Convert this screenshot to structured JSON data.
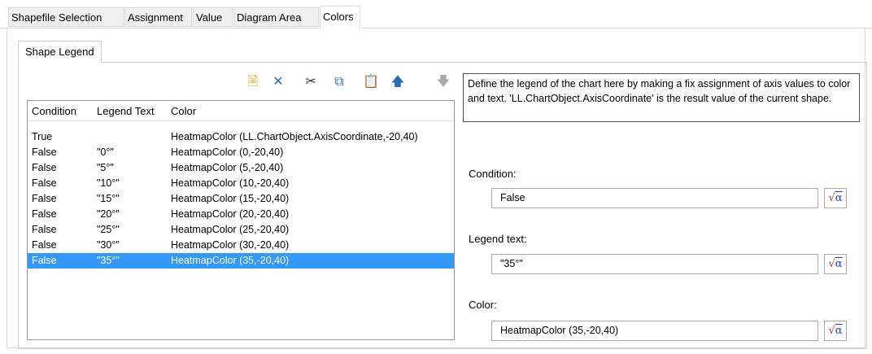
{
  "tabs": [
    "Shapefile Selection",
    "Assignment",
    "Value",
    "Diagram Area",
    "Colors"
  ],
  "active_tab": "Colors",
  "subtab": "Shape Legend",
  "toolbar": {
    "icons": [
      "new-icon",
      "delete-icon",
      "cut-icon",
      "copy-icon",
      "paste-icon",
      "move-up-icon",
      "move-down-icon"
    ],
    "glyphs": [
      "🗎",
      "✕",
      "✂",
      "⧉",
      "📋",
      "🡅",
      "🡇"
    ],
    "colors": [
      "#d4a017",
      "#2b6cb0",
      "#333333",
      "#2b6cb0",
      "#bbbbbb",
      "#2b6cb0",
      "#aaaaaa"
    ]
  },
  "table": {
    "headers": [
      "Condition",
      "Legend Text",
      "Color"
    ],
    "rows": [
      {
        "condition": "True",
        "legend": "",
        "color": "HeatmapColor (LL.ChartObject.AxisCoordinate,-20,40)"
      },
      {
        "condition": "False",
        "legend": "\"0°\"",
        "color": "HeatmapColor (0,-20,40)"
      },
      {
        "condition": "False",
        "legend": "\"5°\"",
        "color": "HeatmapColor (5,-20,40)"
      },
      {
        "condition": "False",
        "legend": "\"10°\"",
        "color": "HeatmapColor (10,-20,40)"
      },
      {
        "condition": "False",
        "legend": "\"15°\"",
        "color": "HeatmapColor (15,-20,40)"
      },
      {
        "condition": "False",
        "legend": "\"20°\"",
        "color": "HeatmapColor (20,-20,40)"
      },
      {
        "condition": "False",
        "legend": "\"25°\"",
        "color": "HeatmapColor (25,-20,40)"
      },
      {
        "condition": "False",
        "legend": "\"30°\"",
        "color": "HeatmapColor (30,-20,40)"
      },
      {
        "condition": "False",
        "legend": "\"35°\"",
        "color": "HeatmapColor (35,-20,40)"
      }
    ],
    "selected_index": 8,
    "selection_color": "#3399ff"
  },
  "description": "Define the legend of the chart here by making a fix assignment of axis values to color and text. 'LL.ChartObject.AxisCoordinate' is the result value of the current shape.",
  "fields": {
    "condition": {
      "label": "Condition:",
      "value": "False"
    },
    "legend_text": {
      "label": "Legend text:",
      "value": "\"35°\""
    },
    "color": {
      "label": "Color:",
      "value": "HeatmapColor (35,-20,40)"
    }
  },
  "formula_button": {
    "root": "√",
    "alpha": "α"
  }
}
